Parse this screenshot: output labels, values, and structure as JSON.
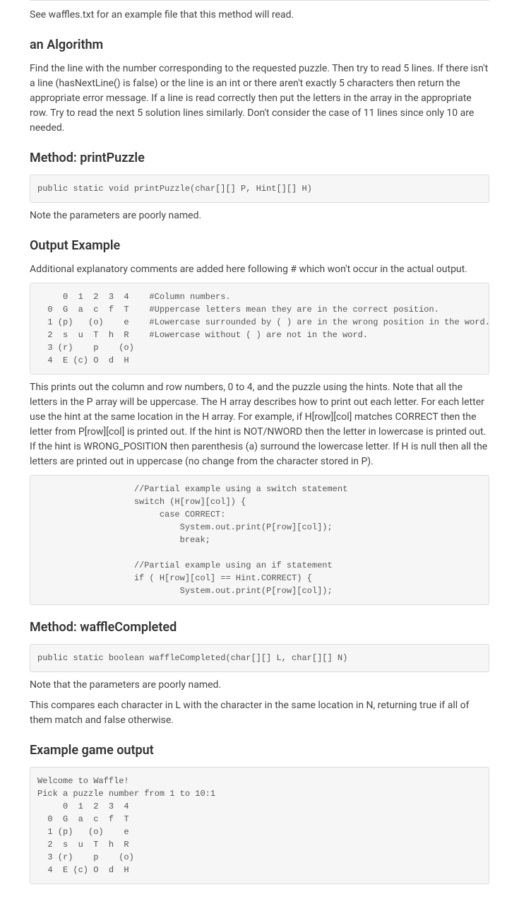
{
  "intro_note": "See waffles.txt for an example file that this method will read.",
  "sections": {
    "algorithm": {
      "heading": "an Algorithm",
      "body": "Find the line with the number corresponding to the requested puzzle. Then try to read 5 lines. If there isn't a line (hasNextLine() is false) or the line is an int or there aren't exactly 5 characters then return the appropriate error message. If a line is read correctly then put the letters in the array in the appropriate row. Try to read the next 5 solution lines similarly. Don't consider the case of 11 lines since only 10 are needed."
    },
    "printPuzzle": {
      "heading": "Method: printPuzzle",
      "signature": "public static void printPuzzle(char[][] P, Hint[][] H)",
      "note": "Note the parameters are poorly named."
    },
    "outputExample": {
      "heading": "Output Example",
      "intro": "Additional explanatory comments are added here following # which won't occur in the actual output.",
      "code": "     0  1  2  3  4    #Column numbers.\n  0  G  a  c  f  T    #Uppercase letters mean they are in the correct position.\n  1 (p)   (o)    e    #Lowercase surrounded by ( ) are in the wrong position in the word.\n  2  s  u  T  h  R    #Lowercase without ( ) are not in the word.\n  3 (r)    p    (o)\n  4  E (c) O  d  H",
      "description": "This prints out the column and row numbers, 0 to 4, and the puzzle using the hints. Note that all the letters in the P array will be uppercase. The H array describes how to print out each letter. For each letter use the hint at the same location in the H array. For example, if H[row][col] matches CORRECT then the letter from P[row][col] is printed out. If the hint is NOT/NWORD then the letter in lowercase is printed out. If the hint is WRONG_POSITION then parenthesis (a) surround the lowercase letter. If H is null then all the letters are printed out in uppercase (no change from the character stored in P).",
      "partial_code": "                   //Partial example using a switch statement\n                   switch (H[row][col]) {\n                        case CORRECT:\n                            System.out.print(P[row][col]);\n                            break;\n\n                   //Partial example using an if statement\n                   if ( H[row][col] == Hint.CORRECT) {\n                            System.out.print(P[row][col]);"
    },
    "waffleCompleted": {
      "heading": "Method: waffleCompleted",
      "signature": "public static boolean waffleCompleted(char[][] L, char[][] N)",
      "note1": "Note that the parameters are poorly named.",
      "note2": "This compares each character in L with the character in the same location in N, returning true if all of them match and false otherwise."
    },
    "exampleGame": {
      "heading": "Example game output",
      "code": "Welcome to Waffle!\nPick a puzzle number from 1 to 10:1\n     0  1  2  3  4\n  0  G  a  c  f  T\n  1 (p)   (o)    e\n  2  s  u  T  h  R\n  3 (r)    p    (o)\n  4  E (c) O  d  H"
    }
  }
}
